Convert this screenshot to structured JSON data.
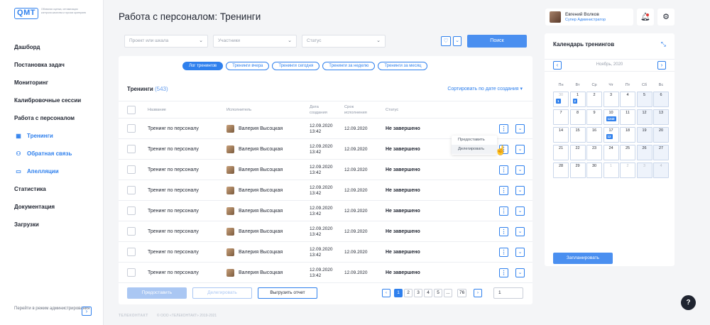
{
  "logo": {
    "mark": "QMT",
    "text": "Облачная оценка, оптимизация контроля качества и прочих критериев"
  },
  "nav": [
    {
      "label": "Дашборд",
      "icon": ""
    },
    {
      "label": "Постановка задач",
      "icon": ""
    },
    {
      "label": "Мониторинг",
      "icon": ""
    },
    {
      "label": "Калибровочные сессии",
      "icon": ""
    },
    {
      "label": "Работа с персоналом",
      "icon": ""
    },
    {
      "label": "Тренинги",
      "icon": "calendar-icon"
    },
    {
      "label": "Обратная связь",
      "icon": "people-icon"
    },
    {
      "label": "Апелляции",
      "icon": "chat-icon"
    },
    {
      "label": "Статистика",
      "icon": ""
    },
    {
      "label": "Документация",
      "icon": ""
    },
    {
      "label": "Загрузки",
      "icon": ""
    }
  ],
  "admin_switch": "Перейти в режим администрирования",
  "page_title": "Работа с персоналом: Тренинги",
  "filters": {
    "project": "Проект или шкала",
    "participants": "Участники",
    "status": "Статус",
    "search": "Поиск"
  },
  "chips": [
    "Лог тренингов",
    "Тренинги вчера",
    "Тренинги сегодня",
    "Тренинги за неделю",
    "Тренинги за месяц"
  ],
  "list": {
    "title": "Тренинги",
    "count": "(543)",
    "sort": "Сортировать по дате создания"
  },
  "columns": {
    "name": "Название",
    "executor": "Исполнитель",
    "created": "Дата\nсоздания",
    "deadline": "Срок\nисполнения",
    "status": "Статус"
  },
  "rows": [
    {
      "name": "Тренинг по персоналу",
      "executor": "Валерия Высоцкая",
      "created_date": "12.09.2020",
      "created_time": "13:42",
      "deadline": "12.09.2020",
      "status": "Не завершено"
    },
    {
      "name": "Тренинг по персоналу",
      "executor": "Валерия Высоцкая",
      "created_date": "12.09.2020",
      "created_time": "13:42",
      "deadline": "12.09.2020",
      "status": "Не завершено"
    },
    {
      "name": "Тренинг по персоналу",
      "executor": "Валерия Высоцкая",
      "created_date": "12.09.2020",
      "created_time": "13:42",
      "deadline": "12.09.2020",
      "status": "Не завершено"
    },
    {
      "name": "Тренинг по персоналу",
      "executor": "Валерия Высоцкая",
      "created_date": "12.09.2020",
      "created_time": "13:42",
      "deadline": "12.09.2020",
      "status": "Не завершено"
    },
    {
      "name": "Тренинг по персоналу",
      "executor": "Валерия Высоцкая",
      "created_date": "12.09.2020",
      "created_time": "13:42",
      "deadline": "12.09.2020",
      "status": "Не завершено"
    },
    {
      "name": "Тренинг по персоналу",
      "executor": "Валерия Высоцкая",
      "created_date": "12.09.2020",
      "created_time": "13:42",
      "deadline": "12.09.2020",
      "status": "Не завершено"
    },
    {
      "name": "Тренинг по персоналу",
      "executor": "Валерия Высоцкая",
      "created_date": "12.09.2020",
      "created_time": "13:42",
      "deadline": "12.09.2020",
      "status": "Не завершено"
    },
    {
      "name": "Тренинг по персоналу",
      "executor": "Валерия Высоцкая",
      "created_date": "12.09.2020",
      "created_time": "13:42",
      "deadline": "12.09.2020",
      "status": "Не завершено"
    }
  ],
  "row_menu": [
    "Предоставить",
    "Делегировать"
  ],
  "actions": {
    "provide": "Предоставить",
    "delegate": "Делегировать",
    "export": "Выгрузить отчет"
  },
  "pagination": {
    "pages": [
      "1",
      "2",
      "3",
      "4",
      "5",
      "...",
      "76"
    ],
    "current": "1",
    "page_input": "1"
  },
  "copyright": {
    "brand": "ТЕЛЕКОНТАКТ",
    "text": "© ООО «ТЕЛЕКОНТАКТ» 2019-2021"
  },
  "user": {
    "name": "Евгений Волков",
    "role": "Супер Администратор"
  },
  "calendar": {
    "title": "Календарь тренингов",
    "month": "Ноябрь, 2020",
    "weekdays": [
      "Пн",
      "Вт",
      "Ср",
      "Чт",
      "Пт",
      "Сб",
      "Вс"
    ],
    "days": [
      "30",
      "1",
      "2",
      "3",
      "4",
      "5",
      "6",
      "7",
      "8",
      "9",
      "10",
      "11",
      "12",
      "13",
      "14",
      "15",
      "16",
      "17",
      "18",
      "19",
      "20",
      "21",
      "22",
      "23",
      "24",
      "25",
      "26",
      "27",
      "28",
      "29",
      "30",
      "1",
      "2",
      "3",
      "4"
    ],
    "badges": [
      {
        "day_index": 0,
        "value": "1"
      },
      {
        "day_index": 1,
        "value": "2"
      },
      {
        "day_index": 10,
        "value": "1243"
      },
      {
        "day_index": 17,
        "value": "12"
      }
    ],
    "plan_button": "Запланировать"
  },
  "help": "?"
}
